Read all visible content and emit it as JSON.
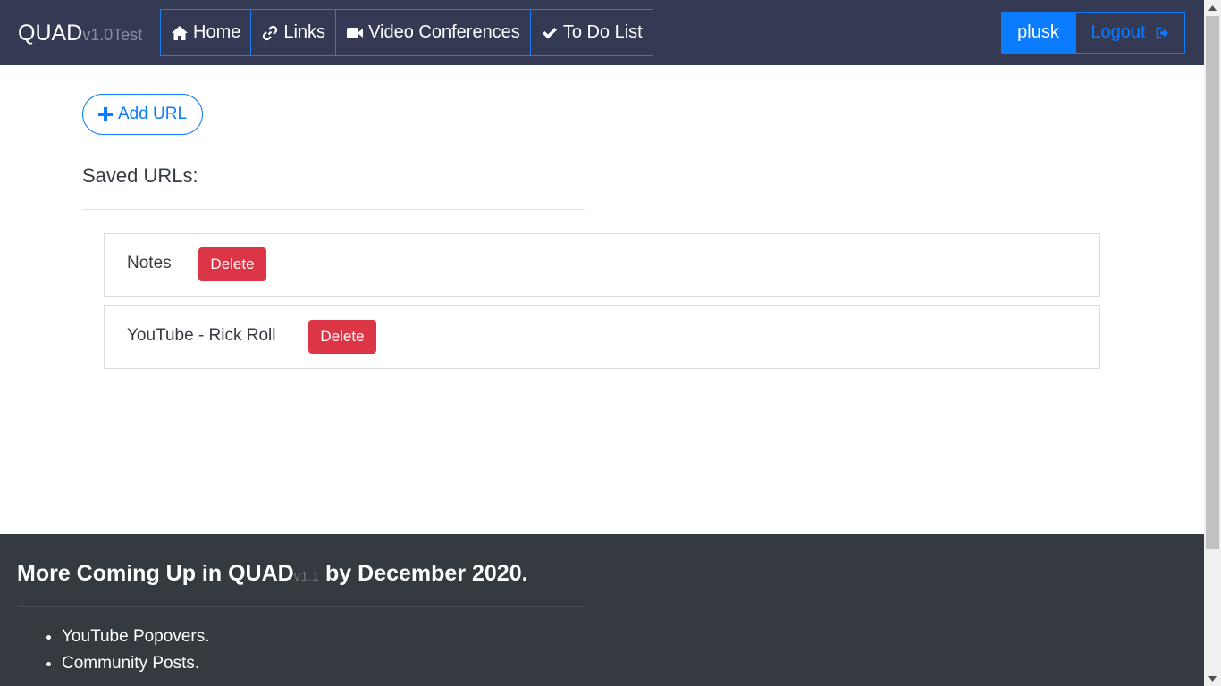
{
  "nav": {
    "brand": "QUAD",
    "brand_version": "v1.0Test",
    "links": [
      {
        "label": "Home",
        "icon": "home-icon"
      },
      {
        "label": "Links",
        "icon": "link-icon"
      },
      {
        "label": "Video Conferences",
        "icon": "video-camera-icon"
      },
      {
        "label": "To Do List",
        "icon": "check-icon"
      }
    ],
    "user": "plusk",
    "logout": "Logout"
  },
  "main": {
    "add_url_label": "Add URL",
    "saved_title": "Saved URLs:",
    "items": [
      {
        "name": "Notes",
        "delete_label": "Delete"
      },
      {
        "name": "YouTube - Rick Roll",
        "delete_label": "Delete"
      }
    ]
  },
  "footer": {
    "title_pre": "More Coming Up in QUAD",
    "title_version": "v1.1",
    "title_post": " by December 2020.",
    "list": [
      "YouTube Popovers.",
      "Community Posts."
    ]
  },
  "colors": {
    "navbar": "#343a54",
    "primary": "#0b7bff",
    "danger": "#dc3545",
    "footer": "#343a40"
  }
}
